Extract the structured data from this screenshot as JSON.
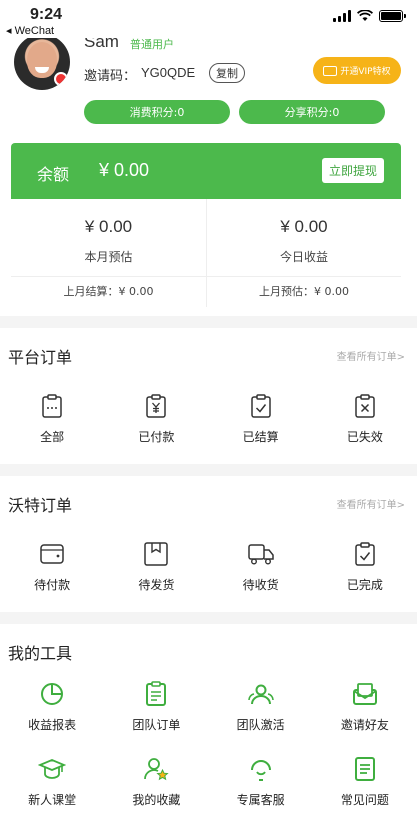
{
  "status_bar": {
    "time": "9:24",
    "back_app": "◂ WeChat"
  },
  "profile": {
    "name": "Sam",
    "level": "普通用户",
    "invite_label": "邀请码：",
    "invite_code": "YG0QDE",
    "copy_label": "复制",
    "vip_label": "开通VIP特权",
    "points": [
      {
        "label": "消费积分:0"
      },
      {
        "label": "分享积分:0"
      }
    ]
  },
  "balance": {
    "label": "余额",
    "value": "¥ 0.00",
    "withdraw_label": "立即提现",
    "stats": [
      {
        "value": "¥ 0.00",
        "label": "本月预估"
      },
      {
        "value": "¥ 0.00",
        "label": "今日收益"
      }
    ],
    "last_month": [
      {
        "label": "上月结算：¥ 0.00"
      },
      {
        "label": "上月预估：¥ 0.00"
      }
    ]
  },
  "platform_orders": {
    "title": "平台订单",
    "link": "查看所有订单>",
    "items": [
      {
        "label": "全部",
        "icon": "clipboard-dots-icon"
      },
      {
        "label": "已付款",
        "icon": "clipboard-yen-icon"
      },
      {
        "label": "已结算",
        "icon": "clipboard-check-icon"
      },
      {
        "label": "已失效",
        "icon": "clipboard-x-icon"
      }
    ]
  },
  "wote_orders": {
    "title": "沃特订单",
    "link": "查看所有订单>",
    "items": [
      {
        "label": "待付款",
        "icon": "wallet-icon"
      },
      {
        "label": "待发货",
        "icon": "package-icon"
      },
      {
        "label": "待收货",
        "icon": "truck-icon"
      },
      {
        "label": "已完成",
        "icon": "clipboard-check-icon"
      }
    ]
  },
  "tools": {
    "title": "我的工具",
    "items": [
      {
        "label": "收益报表",
        "icon": "pie-chart-icon"
      },
      {
        "label": "团队订单",
        "icon": "document-list-icon"
      },
      {
        "label": "团队激活",
        "icon": "team-icon"
      },
      {
        "label": "邀请好友",
        "icon": "invite-mail-icon"
      },
      {
        "label": "新人课堂",
        "icon": "graduation-cap-icon"
      },
      {
        "label": "我的收藏",
        "icon": "user-star-icon"
      },
      {
        "label": "专属客服",
        "icon": "headset-icon"
      },
      {
        "label": "常见问题",
        "icon": "faq-document-icon"
      }
    ]
  },
  "colors": {
    "accent": "#4cb94c",
    "vip": "#f6b318",
    "background": "#f4f4f4"
  }
}
